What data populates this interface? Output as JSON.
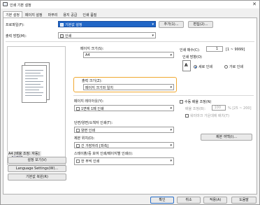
{
  "window": {
    "title": "인쇄 기본 설정"
  },
  "tabs": [
    "기본 설정",
    "페이지 설정",
    "마무리",
    "용지 공급",
    "인쇄 품질"
  ],
  "profile": {
    "label": "프로파일(F):",
    "value": "기본값 설정",
    "add_label": "추가(1)...",
    "edit_label": "편집(2)..."
  },
  "output_method": {
    "label": "출력 방법(M):",
    "value": "인쇄"
  },
  "page_size": {
    "label": "페이지 크기(S):",
    "value": "A4"
  },
  "output_size": {
    "label": "출력 크기(Z):",
    "value": "페이지 크기와 일치"
  },
  "copies": {
    "label": "인쇄 매수(C):",
    "value": "1",
    "range": "[1 ~ 9999]"
  },
  "orientation": {
    "label": "인쇄 방향(O)",
    "portrait": "세로 인쇄",
    "landscape": "가로 인쇄"
  },
  "page_layout": {
    "label": "페이지 레이아웃(Y):",
    "value": "1면에 1페 인쇄"
  },
  "manual_scaling": {
    "label": "수동 배율 조정(N)",
    "scale_label": "배율 조정(B):",
    "scale_value": "100",
    "scale_range": "% [25 ~ 200]",
    "watermark": "워터마크 가운데에 배치(T)"
  },
  "duplex": {
    "label": "단면/양면/소책자 인쇄(T):",
    "value": "양면 인쇄"
  },
  "binding": {
    "label": "제본 위치(D):",
    "value": "긴 가장자리 [좌측]",
    "margin_button": "제본 여백(I)..."
  },
  "stapling": {
    "label": "스테이플/중 보여 인쇄/페이지별 인쇄(I):",
    "value": "한 부씩 인쇄"
  },
  "preview": {
    "caption": "A4 [배율 조정: 자동]"
  },
  "left_buttons": [
    "설정 보기(V)",
    "Language Settings(W)...",
    "기본값 복원(R)"
  ],
  "footer": {
    "ok": "확인",
    "cancel": "취소",
    "apply": "적용(A)",
    "help": "도움말"
  },
  "colors": {
    "accent": "#1a6ad6",
    "highlight": "#f0a830",
    "profile_bg": "#2166c6"
  }
}
